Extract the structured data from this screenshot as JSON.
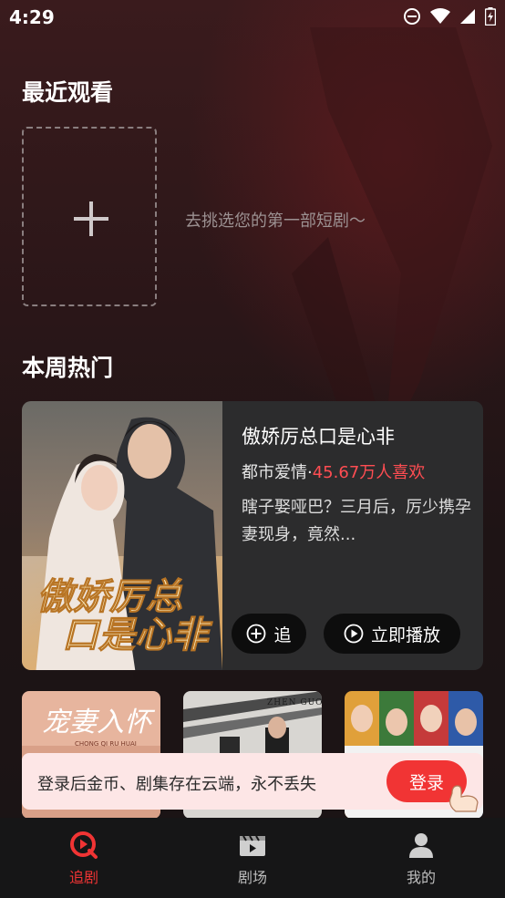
{
  "status_bar": {
    "time": "4:29"
  },
  "recent": {
    "title": "最近观看",
    "empty_hint": "去挑选您的第一部短剧～"
  },
  "hot": {
    "title": "本周热门",
    "featured": {
      "title": "傲娇厉总口是心非",
      "genre": "都市爱情",
      "separator": "·",
      "likes": "45.67万人喜欢",
      "description": "瞎子娶哑巴？三月后，厉少携孕妻现身，竟然...",
      "poster_text_line1": "傲娇厉总",
      "poster_text_line2": "口是心非",
      "follow_label": "追",
      "play_label": "立即播放"
    },
    "thumbnails": [
      {
        "title": "宠妻入怀",
        "subtitle": "CHONG QI RU HUAI"
      },
      {
        "title": "ZHEN GUO ZHIZUN"
      },
      {
        "title": ""
      }
    ]
  },
  "login_banner": {
    "text": "登录后金币、剧集存在云端，永不丢失",
    "button": "登录"
  },
  "tabs": [
    {
      "label": "追剧",
      "icon": "play-circle-icon",
      "active": true
    },
    {
      "label": "剧场",
      "icon": "film-icon",
      "active": false
    },
    {
      "label": "我的",
      "icon": "person-icon",
      "active": false
    }
  ],
  "colors": {
    "accent": "#f13434",
    "likes": "#ff4d52",
    "banner_bg": "#fde6e6"
  }
}
